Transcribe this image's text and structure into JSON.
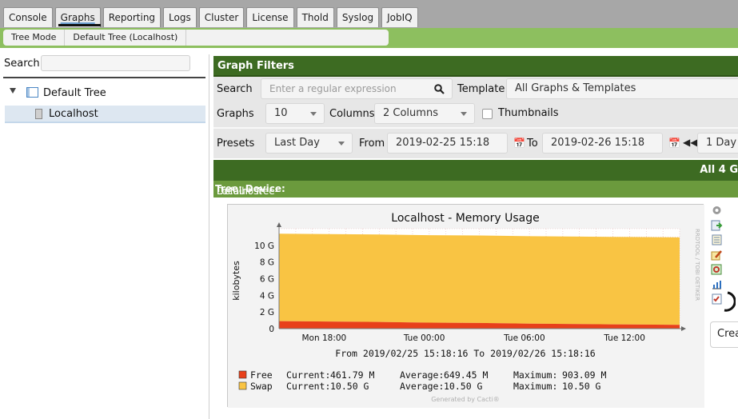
{
  "tabs": [
    "Console",
    "Graphs",
    "Reporting",
    "Logs",
    "Cluster",
    "License",
    "Thold",
    "Syslog",
    "JobIQ"
  ],
  "breadcrumb": [
    "Tree Mode",
    "Default Tree (Localhost)"
  ],
  "left": {
    "search_label": "Search",
    "search_value": "",
    "tree_label": "Default Tree",
    "host_label": "Localhost"
  },
  "filters": {
    "title": "Graph Filters",
    "search_label": "Search",
    "search_placeholder": "Enter a regular expression",
    "template_label": "Template",
    "template_value": "All Graphs & Templates",
    "graphs_label": "Graphs",
    "graphs_value": "10",
    "columns_label": "Columns",
    "columns_value": "2 Columns",
    "thumbnails_label": "Thumbnails",
    "thumbnails_checked": false,
    "presets_label": "Presets",
    "presets_value": "Last Day",
    "from_label": "From",
    "from_value": "2019-02-25 15:18",
    "to_label": "To",
    "to_value": "2019-02-26 15:18",
    "span_value": "1 Day"
  },
  "results": {
    "summary": "All 4 G",
    "path_tree_label": "Tree:",
    "path_tree_value": "Default Tree->",
    "path_device_label": "Device:",
    "path_device_value": "Localhost"
  },
  "create_button": "Crea",
  "colors": {
    "tab_bar": "#a7a7a7",
    "green_bar": "#8dbf5f",
    "header_green": "#3d6b22",
    "free": "#e8401a",
    "swap": "#f9c443"
  },
  "chart_data": {
    "type": "area",
    "title": "Localhost - Memory Usage",
    "ylabel": "kilobytes",
    "ylim": [
      0,
      12
    ],
    "ytick_labels": [
      "0",
      "2 G",
      "4 G",
      "6 G",
      "8 G",
      "10 G"
    ],
    "yticks": [
      0,
      2,
      4,
      6,
      8,
      10
    ],
    "xtick_labels": [
      "Mon 18:00",
      "Tue 00:00",
      "Tue 06:00",
      "Tue 12:00"
    ],
    "xticks_hours": [
      2.7,
      8.7,
      14.7,
      20.7
    ],
    "x_hours": [
      0,
      3,
      6,
      9,
      12,
      15,
      18,
      21,
      24
    ],
    "series": [
      {
        "name": "Free",
        "values": [
          0.9,
          0.85,
          0.8,
          0.72,
          0.68,
          0.6,
          0.55,
          0.5,
          0.46
        ],
        "color": "#e8401a"
      },
      {
        "name": "Swap",
        "values": [
          10.5,
          10.5,
          10.5,
          10.5,
          10.5,
          10.5,
          10.5,
          10.5,
          10.5
        ],
        "color": "#f9c443"
      }
    ],
    "range_text": "From 2019/02/25 15:18:16 To 2019/02/26 15:18:16",
    "legend": [
      {
        "name": "Free",
        "current": "461.79 M",
        "average": "649.45 M",
        "maximum": "903.09 M"
      },
      {
        "name": "Swap",
        "current": "10.50 G",
        "average": "10.50 G",
        "maximum": "10.50 G"
      }
    ],
    "legend_labels": {
      "current": "Current:",
      "average": "Average:",
      "maximum": "Maximum:"
    },
    "side_text": "RRDTOOL / TOBI OETIKER",
    "footer": "Generated by Cacti®"
  }
}
